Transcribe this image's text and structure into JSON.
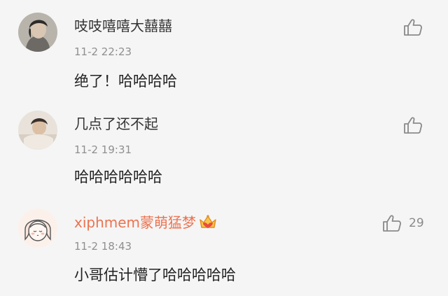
{
  "comments": [
    {
      "username": "吱吱嘻嘻大囍囍",
      "timestamp": "11-2 22:23",
      "content": "绝了！哈哈哈哈",
      "like_count": "",
      "avatar_icon": "user-avatar-photo"
    },
    {
      "username": "几点了还不起",
      "timestamp": "11-2 19:31",
      "content": "哈哈哈哈哈哈",
      "like_count": "",
      "avatar_icon": "user-avatar-photo"
    },
    {
      "username": "xiphmem蒙萌猛梦",
      "timestamp": "11-2 18:43",
      "content": "小哥估计懵了哈哈哈哈哈",
      "like_count": "29",
      "avatar_icon": "cartoon-girl-avatar",
      "badge_icon": "vip-crown-icon"
    }
  ],
  "colors": {
    "background": "#f5f5f5",
    "username": "#333333",
    "vip_username": "#eb7350",
    "timestamp": "#8f8f8f",
    "icon": "#8a8a8a"
  }
}
